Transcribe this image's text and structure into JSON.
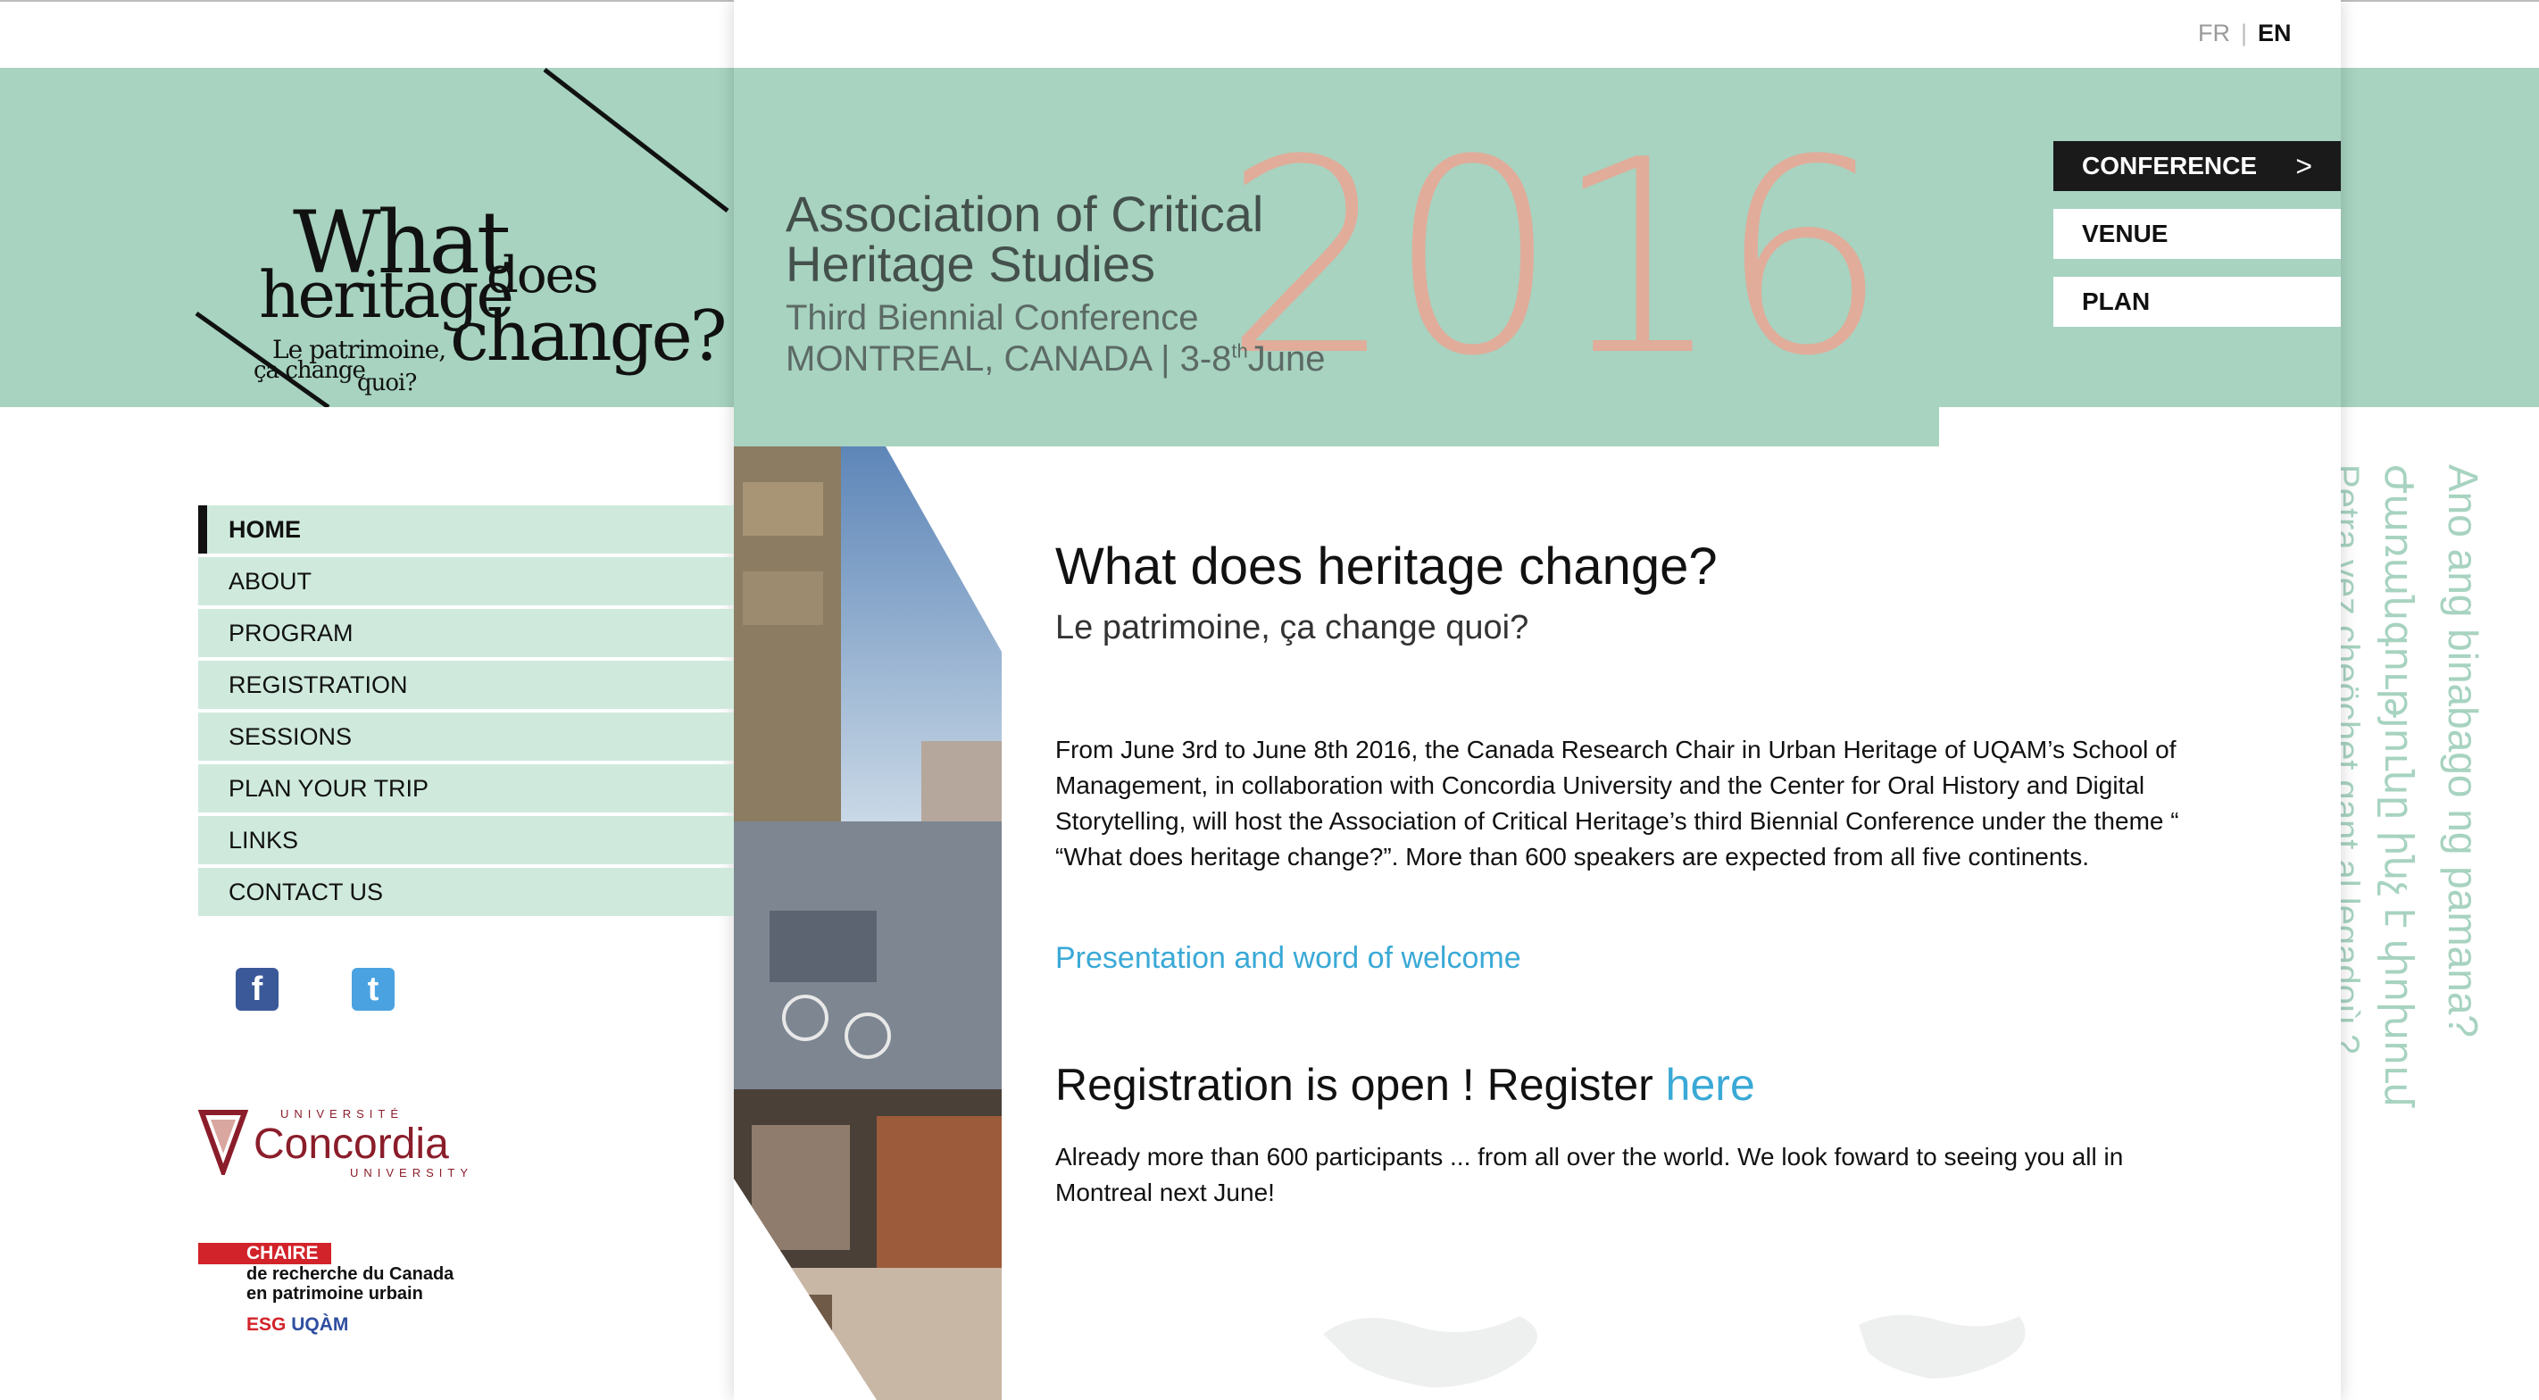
{
  "lang": {
    "fr": "FR",
    "sep": "|",
    "en": "EN"
  },
  "logo": {
    "line_what": "What",
    "line_heritage": "heritage",
    "line_does": "does",
    "line_change": "change?",
    "fr_line1": "Le patrimoine,",
    "fr_line2": "ça change",
    "fr_line3": "quoi?"
  },
  "banner": {
    "org_line1": "Association of Critical",
    "org_line2": "Heritage Studies",
    "conference": "Third Biennial Conference",
    "location": "MONTREAL, CANADA | 3-8",
    "location_sup": "th",
    "location_end": "June",
    "year": "2016"
  },
  "topnav": [
    {
      "label": "CONFERENCE",
      "active": true,
      "chevron": ">"
    },
    {
      "label": "VENUE",
      "active": false
    },
    {
      "label": "PLAN",
      "active": false
    }
  ],
  "sidenav": [
    {
      "label": "HOME",
      "active": true
    },
    {
      "label": "ABOUT"
    },
    {
      "label": "PROGRAM"
    },
    {
      "label": "REGISTRATION"
    },
    {
      "label": "SESSIONS"
    },
    {
      "label": "PLAN YOUR TRIP"
    },
    {
      "label": "LINKS"
    },
    {
      "label": "CONTACT US"
    }
  ],
  "social": {
    "facebook_icon": "facebook-icon",
    "twitter_icon": "twitter-icon",
    "fb_glyph": "f",
    "tw_glyph": "t"
  },
  "partners": {
    "concordia_top": "UNIVERSITÉ",
    "concordia_name": "Concordia",
    "concordia_bottom": "UNIVERSITY",
    "chaire_badge": "CHAIRE",
    "chaire_line1": "de recherche du Canada",
    "chaire_line2": "en patrimoine urbain",
    "esg": "ESG",
    "uqam": "UQÀM"
  },
  "content": {
    "title": "What does heritage change?",
    "subtitle": "Le patrimoine, ça change quoi?",
    "intro": "From June 3rd to June 8th 2016, the Canada Research Chair in Urban Heritage of UQAM’s School of Management, in collaboration with Concordia University and the Center for Oral History and Digital Storytelling, will host the Association of Critical Heritage’s third Biennial Conference under the theme “ “What does heritage change?”. More than 600 speakers are expected from all five continents.",
    "welcome_link": "Presentation and word of welcome",
    "registration_text": "Registration is open ! Register ",
    "registration_link": "here",
    "participants": "Already more than 600 participants ... from all over the world. We look foward to seeing you all in Montreal next June!"
  },
  "vertical_text": {
    "line1": "Ano ang binabago ng pamana?",
    "line2": "Ժառանգությունը ինչ է փոխում",
    "line3": "Petra vez cheöchet gant al legadoù ?"
  },
  "colors": {
    "band": "#a7d3c0",
    "nav_bg": "#cfeadd",
    "year": "#e8a896",
    "link": "#3aa9d6",
    "accent_dark": "#1a1a1a"
  }
}
